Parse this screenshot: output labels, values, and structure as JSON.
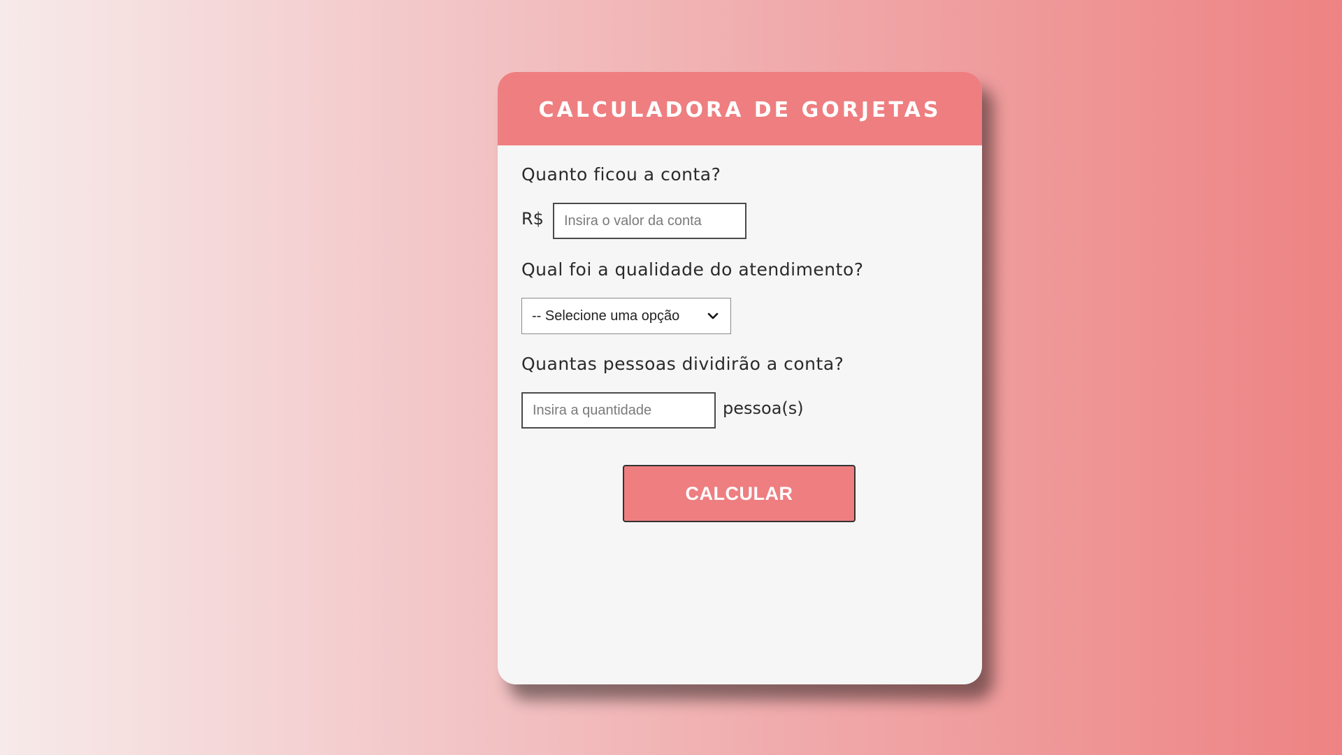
{
  "app": {
    "title": "CALCULADORA DE GORJETAS"
  },
  "bill": {
    "question": "Quanto ficou a conta?",
    "currency": "R$",
    "placeholder": "Insira o valor da conta",
    "value": ""
  },
  "service": {
    "question": "Qual foi a qualidade do atendimento?",
    "selected": "-- Selecione uma opção"
  },
  "people": {
    "question": "Quantas pessoas dividirão a conta?",
    "placeholder": "Insira a quantidade",
    "value": "",
    "unit": "pessoa(s)"
  },
  "actions": {
    "calculate_label": "CALCULAR"
  },
  "colors": {
    "accent": "#ee7e80",
    "card_background": "#f6f6f6",
    "gradient_start": "#f7eaea",
    "gradient_end": "#ee8383"
  },
  "icons": {
    "select_arrow": "chevron-down-icon"
  }
}
